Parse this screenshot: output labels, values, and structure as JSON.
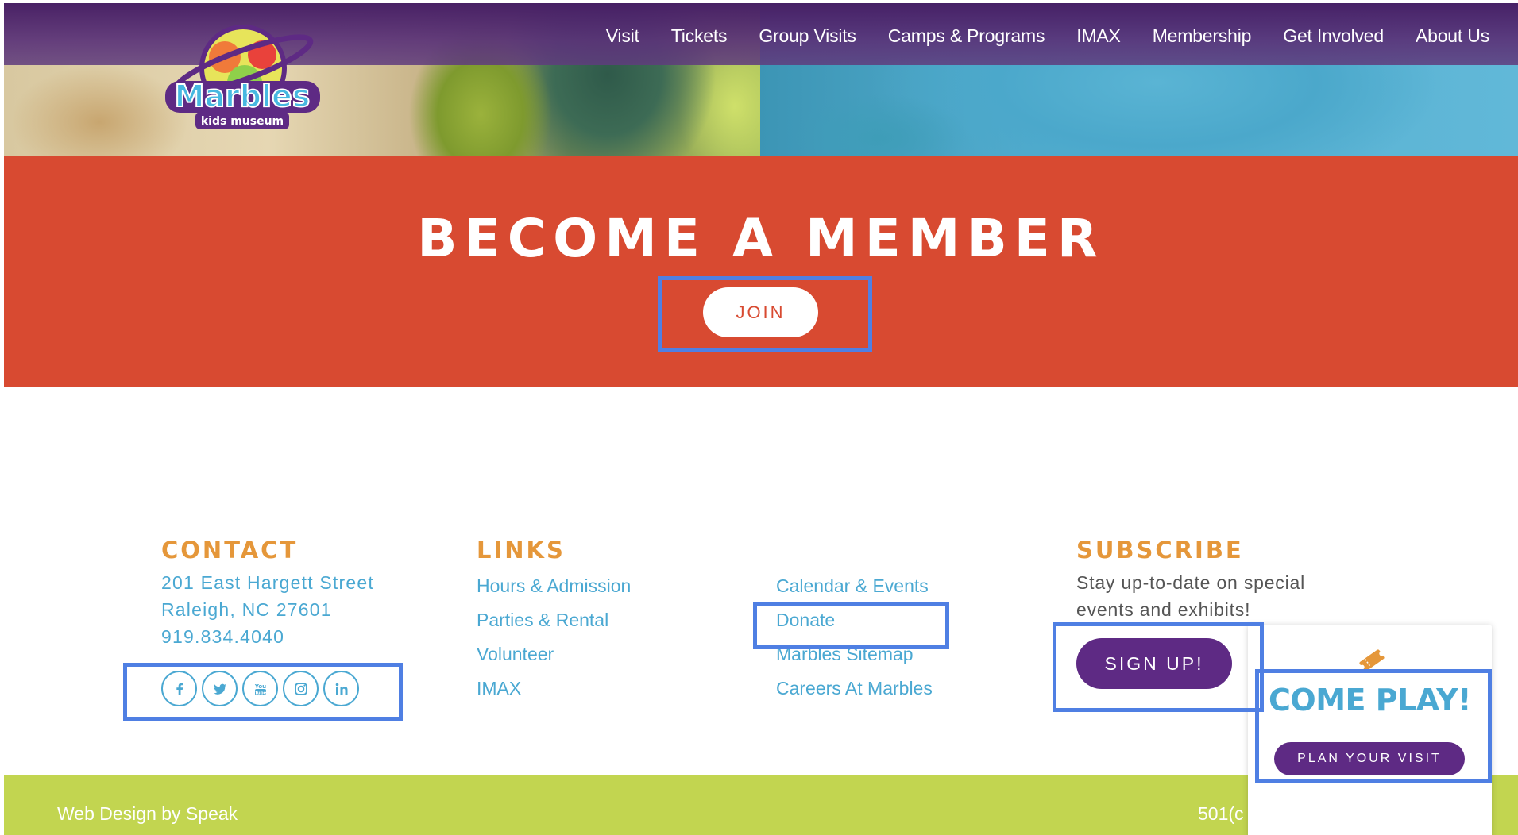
{
  "nav": {
    "items": [
      "Visit",
      "Tickets",
      "Group Visits",
      "Camps & Programs",
      "IMAX",
      "Membership",
      "Get Involved",
      "About Us"
    ]
  },
  "logo": {
    "text": "Marbles",
    "sub": "kids museum"
  },
  "member": {
    "title": "BECOME A MEMBER",
    "join_label": "JOIN"
  },
  "contact": {
    "heading": "CONTACT",
    "address1": "201 East Hargett Street",
    "address2": "Raleigh, NC 27601",
    "phone": "919.834.4040",
    "social": [
      "facebook-icon",
      "twitter-icon",
      "youtube-icon",
      "instagram-icon",
      "linkedin-icon"
    ]
  },
  "links": {
    "heading": "LINKS",
    "col1": [
      "Hours & Admission",
      "Parties & Rental",
      "Volunteer",
      "IMAX"
    ],
    "col2": [
      "Calendar & Events",
      "Donate",
      "Marbles Sitemap",
      "Careers At Marbles"
    ]
  },
  "subscribe": {
    "heading": "SUBSCRIBE",
    "line1": "Stay up-to-date on special",
    "line2": "events and exhibits!",
    "button": "SIGN UP!"
  },
  "footer": {
    "credit": "Web Design by Speak",
    "legal": "501(c"
  },
  "card": {
    "title": "COME PLAY!",
    "button": "PLAN YOUR VISIT"
  },
  "colors": {
    "nav_bg": "#461e64",
    "member_bg": "#d84a31",
    "heading_orange": "#e5973a",
    "link_blue": "#4aa8d2",
    "button_purple": "#5e2a84",
    "footer_green": "#c2d550",
    "highlight": "#4f7fe3"
  }
}
